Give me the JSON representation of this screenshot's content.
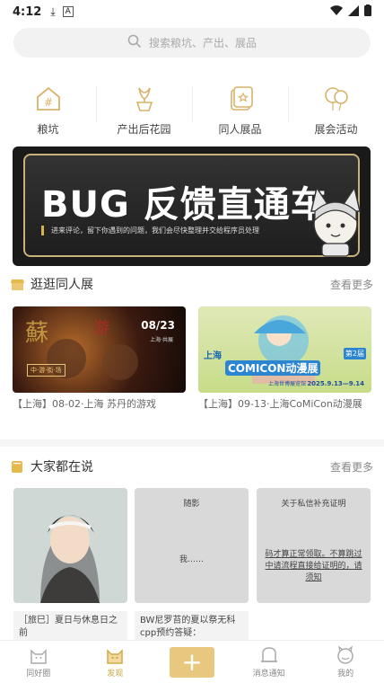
{
  "status_bar": {
    "time": "4:12",
    "download_icon": "download-icon",
    "a_icon": "A"
  },
  "search": {
    "placeholder": "搜索粮坑、产出、展品"
  },
  "categories": [
    {
      "label": "粮坑",
      "icon": "hashtag-icon"
    },
    {
      "label": "产出后花园",
      "icon": "flower-pot-icon"
    },
    {
      "label": "同人展品",
      "icon": "card-icon"
    },
    {
      "label": "展会活动",
      "icon": "balloon-icon"
    }
  ],
  "banner": {
    "title": "BUG 反馈直通车",
    "subtitle": "进来评论，留下你遇到的问题，我们会尽快整理并交给程序员处理"
  },
  "section_expo": {
    "title": "逛逛同人展",
    "more": "查看更多"
  },
  "expos": [
    {
      "caption": "【上海】08-02·上海 苏丹的游戏",
      "img_text_1": "08/23",
      "img_text_2": "上海·共展",
      "img_text_3": "中·游·街·场"
    },
    {
      "caption": "【上海】09-13·上海CoMiCon动漫展",
      "img_text_1": "上海",
      "img_text_2": "COMICON动漫展",
      "img_text_3": "2025.9.13—9.14",
      "img_text_4": "第2届",
      "img_text_5": "上海世博展览馆"
    }
  ],
  "section_posts": {
    "title": "大家都在说",
    "more": "查看更多"
  },
  "posts": [
    {
      "caption": "［旅巳］夏日与休息日之前"
    },
    {
      "title": "随影",
      "body": "我……",
      "caption": "BW尼罗苔的夏以祭无科cpp预约答疑："
    },
    {
      "title": "关于私信补充证明",
      "body": "码才算正常领取。不算跳过中请流程直接给证明的，请须知"
    }
  ],
  "tabbar": [
    {
      "label": "同好圈",
      "icon": "cat-icon"
    },
    {
      "label": "发现",
      "icon": "cat-icon",
      "active": true
    },
    {
      "label": "+",
      "icon": "plus-icon"
    },
    {
      "label": "消息通知",
      "icon": "bell-cat-icon"
    },
    {
      "label": "我的",
      "icon": "smile-cat-icon"
    }
  ],
  "colors": {
    "accent": "#d2a948",
    "plus_button": "#e8c87e",
    "icon_gold": "#d8b26a"
  }
}
